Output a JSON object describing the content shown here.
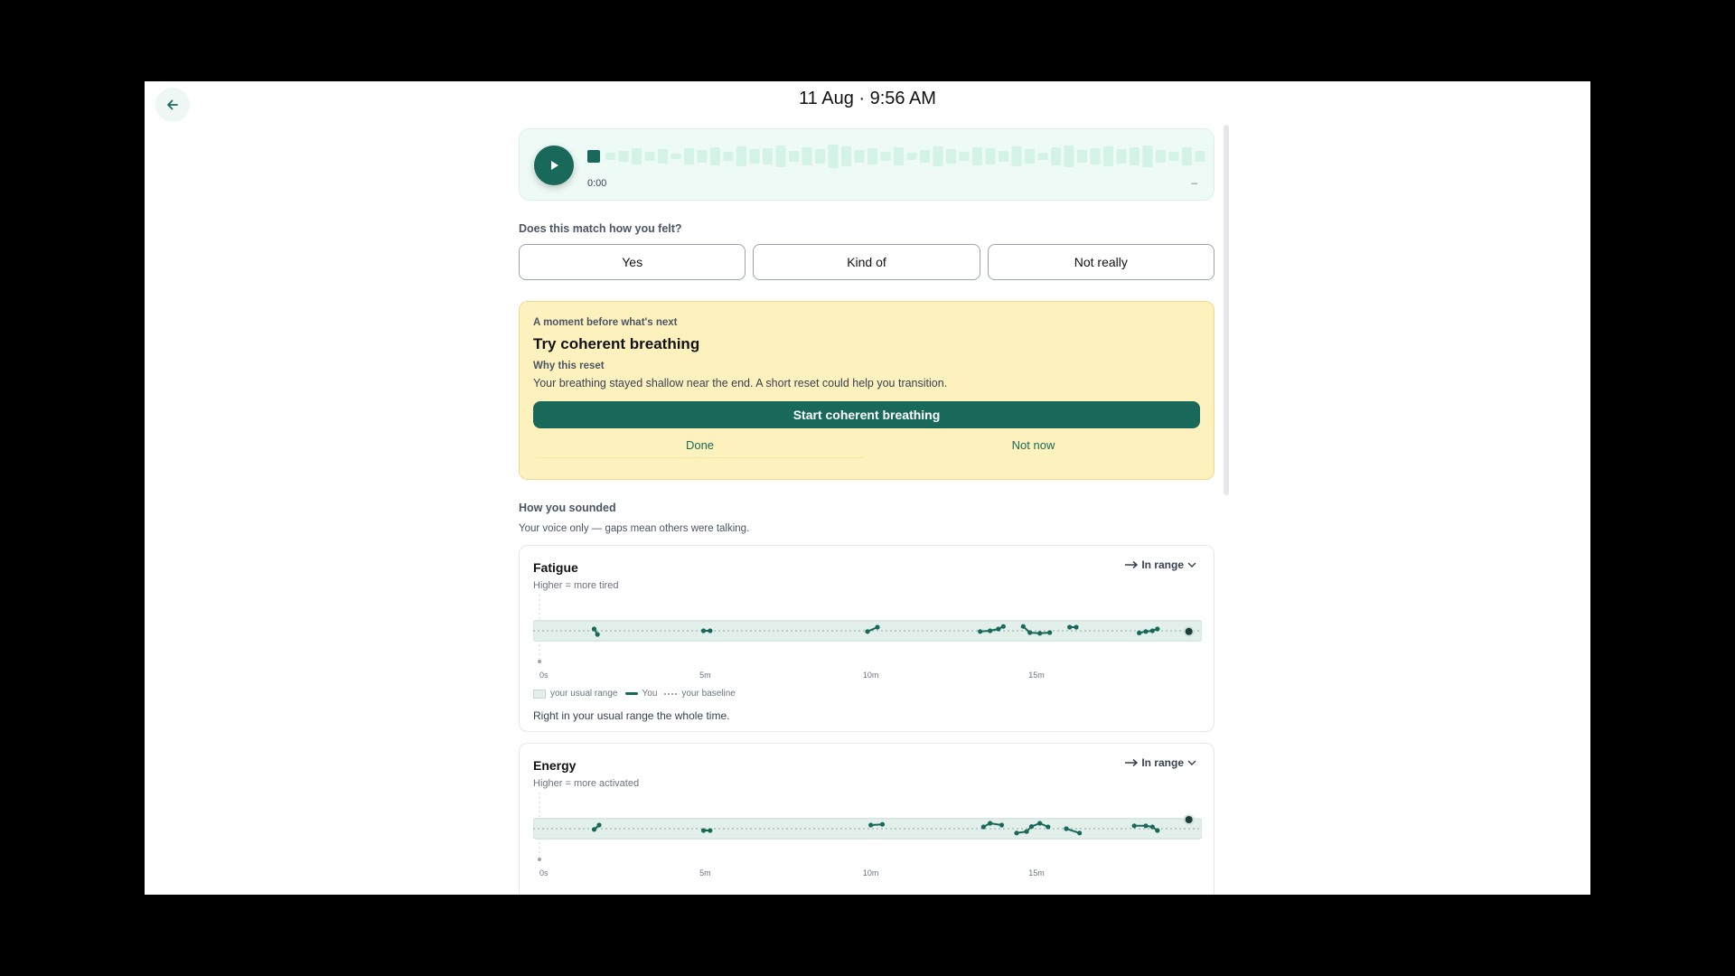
{
  "header": {
    "title": "11 Aug · 9:56 AM"
  },
  "player": {
    "time": "0:00",
    "duration": "–"
  },
  "feedback": {
    "question": "Does this match how you felt?",
    "options": [
      "Yes",
      "Kind of",
      "Not really"
    ]
  },
  "reset_card": {
    "kicker": "A moment before what's next",
    "title": "Try coherent breathing",
    "why_label": "Why this reset",
    "reason": "Your breathing stayed shallow near the end. A short reset could help you transition.",
    "start_label": "Start coherent breathing",
    "done_label": "Done",
    "not_now_label": "Not now"
  },
  "sounded": {
    "title": "How you sounded",
    "subtitle": "Your voice only — gaps mean others were talking."
  },
  "legend": {
    "range": "your usual range",
    "you": "You",
    "baseline": "your baseline"
  },
  "metrics": [
    {
      "name": "Fatigue",
      "hint": "Higher = more tired",
      "status": "In range",
      "summary": "Right in your usual range the whole time."
    },
    {
      "name": "Energy",
      "hint": "Higher = more activated",
      "status": "In range"
    }
  ],
  "colors": {
    "accent": "#19695a",
    "range_fill": "#e3efeb",
    "reset_bg": "#fdf1bd",
    "player_bg": "#eefaf6"
  },
  "chart_data": [
    {
      "type": "line",
      "name": "Fatigue",
      "x_unit": "minutes",
      "xticks": [
        "0s",
        "5m",
        "10m",
        "15m"
      ],
      "xlim": [
        0,
        19.8
      ],
      "ylim": [
        -1,
        1
      ],
      "band": [
        -0.28,
        0.28
      ],
      "baseline": 0,
      "segments": [
        [
          [
            1.65,
            0.05
          ],
          [
            1.75,
            -0.1
          ]
        ],
        [
          [
            4.95,
            0.0
          ],
          [
            5.15,
            0.0
          ]
        ],
        [
          [
            9.9,
            -0.02
          ],
          [
            10.2,
            0.1
          ]
        ],
        [
          [
            13.3,
            -0.02
          ],
          [
            13.6,
            0.0
          ],
          [
            13.85,
            0.05
          ],
          [
            14.0,
            0.12
          ]
        ],
        [
          [
            14.6,
            0.12
          ],
          [
            14.8,
            -0.05
          ],
          [
            15.1,
            -0.07
          ],
          [
            15.4,
            -0.05
          ]
        ],
        [
          [
            16.0,
            0.1
          ],
          [
            16.2,
            0.1
          ]
        ],
        [
          [
            18.1,
            -0.06
          ],
          [
            18.3,
            -0.02
          ],
          [
            18.5,
            0.0
          ],
          [
            18.65,
            0.05
          ]
        ]
      ],
      "current": [
        19.6,
        -0.02
      ],
      "legend": [
        "your usual range",
        "You",
        "your baseline"
      ],
      "annotation": "Right in your usual range the whole time."
    },
    {
      "type": "line",
      "name": "Energy",
      "x_unit": "minutes",
      "xticks": [
        "0s",
        "5m",
        "10m",
        "15m"
      ],
      "xlim": [
        0,
        19.8
      ],
      "ylim": [
        -1,
        1
      ],
      "band": [
        -0.28,
        0.28
      ],
      "baseline": 0,
      "segments": [
        [
          [
            1.65,
            -0.02
          ],
          [
            1.8,
            0.1
          ]
        ],
        [
          [
            4.95,
            -0.05
          ],
          [
            5.15,
            -0.05
          ]
        ],
        [
          [
            10.0,
            0.1
          ],
          [
            10.35,
            0.12
          ]
        ],
        [
          [
            13.4,
            0.05
          ],
          [
            13.6,
            0.15
          ],
          [
            13.95,
            0.1
          ]
        ],
        [
          [
            14.4,
            -0.12
          ],
          [
            14.7,
            -0.08
          ],
          [
            14.85,
            0.06
          ],
          [
            15.1,
            0.15
          ],
          [
            15.35,
            0.05
          ]
        ],
        [
          [
            15.9,
            0.0
          ],
          [
            16.3,
            -0.12
          ]
        ],
        [
          [
            17.95,
            0.08
          ],
          [
            18.3,
            0.08
          ],
          [
            18.5,
            0.05
          ],
          [
            18.65,
            -0.05
          ]
        ]
      ],
      "current": [
        19.6,
        0.25
      ]
    }
  ]
}
